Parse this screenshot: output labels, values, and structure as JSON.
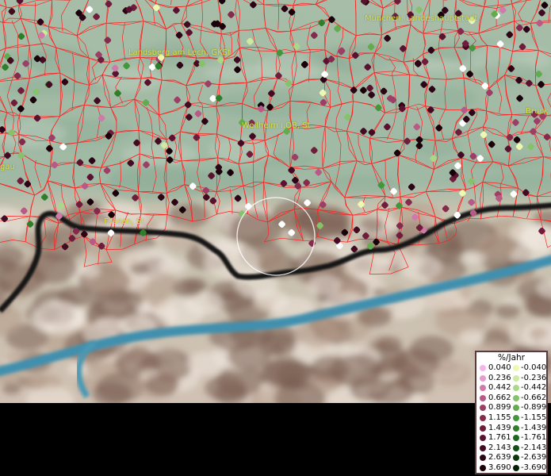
{
  "map": {
    "labels": [
      {
        "id": "muenchen",
        "text": "München, Landeshauptstadt"
      },
      {
        "id": "landsberg",
        "text": "Landsberg am Lech, GKSt"
      },
      {
        "id": "weilheim",
        "text": "Weilheim i.OB, St"
      },
      {
        "id": "fuessen",
        "text": "Füssen, St"
      },
      {
        "id": "bruck",
        "text": "Bruck"
      },
      {
        "id": "west",
        "text": "gau"
      }
    ],
    "colors": {
      "terrain_lowland": "#a8bfa8",
      "terrain_alps": "#c9b7a6",
      "boundaries": "#ff1a1a",
      "border": "#111111",
      "river": "#3a8fb0"
    }
  },
  "legend": {
    "title": "%/Jahr",
    "positive": [
      {
        "label": "0.040",
        "color": "#f4b5e8"
      },
      {
        "label": "0.236",
        "color": "#e79ccf"
      },
      {
        "label": "0.442",
        "color": "#d07aa9"
      },
      {
        "label": "0.662",
        "color": "#b85a86"
      },
      {
        "label": "0.899",
        "color": "#9c3e66"
      },
      {
        "label": "1.155",
        "color": "#852a4c"
      },
      {
        "label": "1.439",
        "color": "#701d3c"
      },
      {
        "label": "1.761",
        "color": "#5a1230"
      },
      {
        "label": "2.143",
        "color": "#430a22"
      },
      {
        "label": "2.639",
        "color": "#2d0416"
      },
      {
        "label": "3.690",
        "color": "#1a000a"
      }
    ],
    "negative": [
      {
        "label": "-0.040",
        "color": "#eef8b0"
      },
      {
        "label": "-0.236",
        "color": "#cdeaa0"
      },
      {
        "label": "-0.442",
        "color": "#a9d987"
      },
      {
        "label": "-0.662",
        "color": "#85c26a"
      },
      {
        "label": "-0.899",
        "color": "#63ac4e"
      },
      {
        "label": "-1.155",
        "color": "#44963a"
      },
      {
        "label": "-1.439",
        "color": "#2f7e2a"
      },
      {
        "label": "-1.761",
        "color": "#1f661e"
      },
      {
        "label": "-2.143",
        "color": "#124f13"
      },
      {
        "label": "-2.639",
        "color": "#09380b"
      },
      {
        "label": "-3.690",
        "color": "#032204"
      }
    ]
  }
}
